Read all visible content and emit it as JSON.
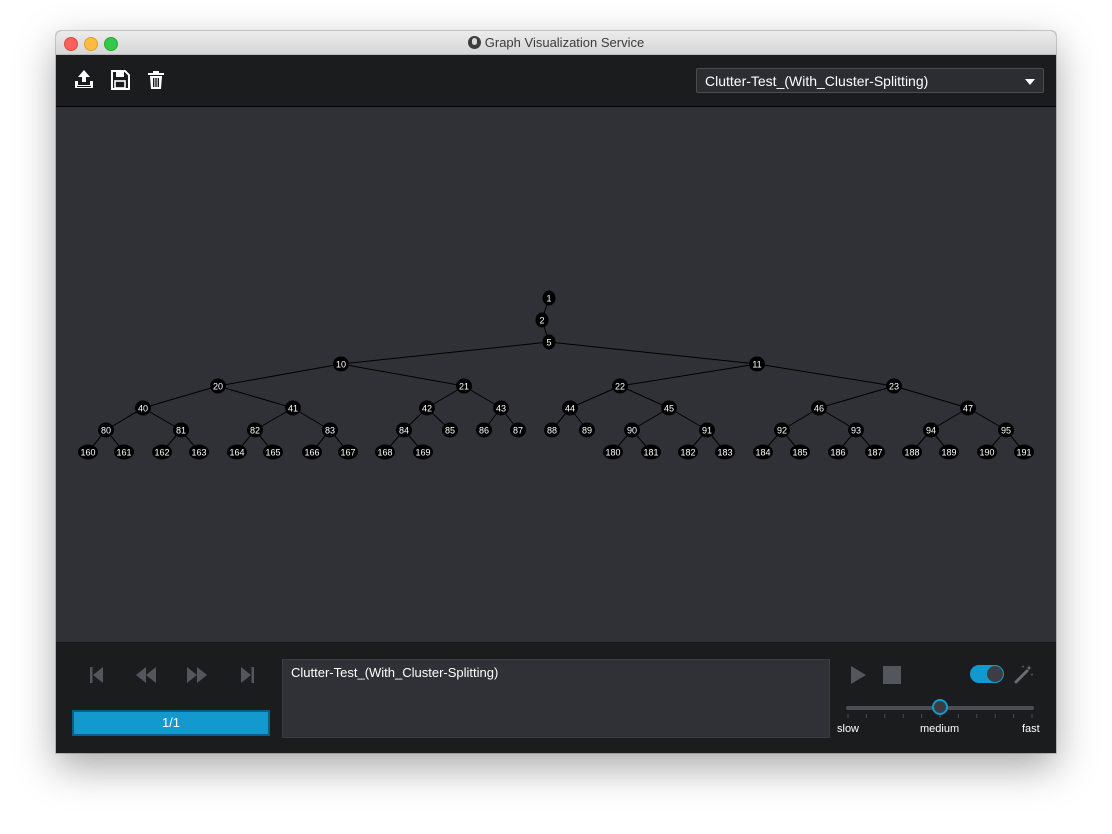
{
  "window": {
    "title": "Graph Visualization Service"
  },
  "toolbar": {
    "icons": [
      "upload-icon",
      "save-icon",
      "trash-icon"
    ],
    "graph_select": {
      "value": "Clutter-Test_(With_Cluster-Splitting)"
    }
  },
  "graph": {
    "nodes": [
      {
        "id": "1",
        "parent": null
      },
      {
        "id": "2",
        "parent": "1"
      },
      {
        "id": "5",
        "parent": "2"
      },
      {
        "id": "10",
        "parent": "5"
      },
      {
        "id": "11",
        "parent": "5"
      },
      {
        "id": "20",
        "parent": "10"
      },
      {
        "id": "21",
        "parent": "10"
      },
      {
        "id": "22",
        "parent": "11"
      },
      {
        "id": "23",
        "parent": "11"
      },
      {
        "id": "40",
        "parent": "20"
      },
      {
        "id": "41",
        "parent": "20"
      },
      {
        "id": "42",
        "parent": "21"
      },
      {
        "id": "43",
        "parent": "21"
      },
      {
        "id": "44",
        "parent": "22"
      },
      {
        "id": "45",
        "parent": "22"
      },
      {
        "id": "46",
        "parent": "23"
      },
      {
        "id": "47",
        "parent": "23"
      },
      {
        "id": "80",
        "parent": "40"
      },
      {
        "id": "81",
        "parent": "40"
      },
      {
        "id": "82",
        "parent": "41"
      },
      {
        "id": "83",
        "parent": "41"
      },
      {
        "id": "84",
        "parent": "42"
      },
      {
        "id": "85",
        "parent": "42"
      },
      {
        "id": "86",
        "parent": "43"
      },
      {
        "id": "87",
        "parent": "43"
      },
      {
        "id": "88",
        "parent": "44"
      },
      {
        "id": "89",
        "parent": "44"
      },
      {
        "id": "90",
        "parent": "45"
      },
      {
        "id": "91",
        "parent": "45"
      },
      {
        "id": "92",
        "parent": "46"
      },
      {
        "id": "93",
        "parent": "46"
      },
      {
        "id": "94",
        "parent": "47"
      },
      {
        "id": "95",
        "parent": "47"
      },
      {
        "id": "160",
        "parent": "80"
      },
      {
        "id": "161",
        "parent": "80"
      },
      {
        "id": "162",
        "parent": "81"
      },
      {
        "id": "163",
        "parent": "81"
      },
      {
        "id": "164",
        "parent": "82"
      },
      {
        "id": "165",
        "parent": "82"
      },
      {
        "id": "166",
        "parent": "83"
      },
      {
        "id": "167",
        "parent": "83"
      },
      {
        "id": "168",
        "parent": "84"
      },
      {
        "id": "169",
        "parent": "84"
      },
      {
        "id": "180",
        "parent": "90"
      },
      {
        "id": "181",
        "parent": "90"
      },
      {
        "id": "182",
        "parent": "91"
      },
      {
        "id": "183",
        "parent": "91"
      },
      {
        "id": "184",
        "parent": "92"
      },
      {
        "id": "185",
        "parent": "92"
      },
      {
        "id": "186",
        "parent": "93"
      },
      {
        "id": "187",
        "parent": "93"
      },
      {
        "id": "188",
        "parent": "94"
      },
      {
        "id": "189",
        "parent": "94"
      },
      {
        "id": "190",
        "parent": "95"
      },
      {
        "id": "191",
        "parent": "95"
      }
    ]
  },
  "playback": {
    "nav_icons": [
      "skip-first-icon",
      "rewind-icon",
      "fast-forward-icon",
      "skip-last-icon"
    ],
    "progress_label": "1/1",
    "progress_fraction": 1.0,
    "description": "Clutter-Test_(With_Cluster-Splitting)",
    "toggle_on": true,
    "speed": {
      "labels": [
        "slow",
        "medium",
        "fast"
      ],
      "value": "medium"
    }
  },
  "colors": {
    "accent": "#1499cf",
    "canvas_bg": "#2f3136",
    "chrome_bg": "#1b1c1e",
    "node_fill": "#000000",
    "edge": "#000000"
  }
}
